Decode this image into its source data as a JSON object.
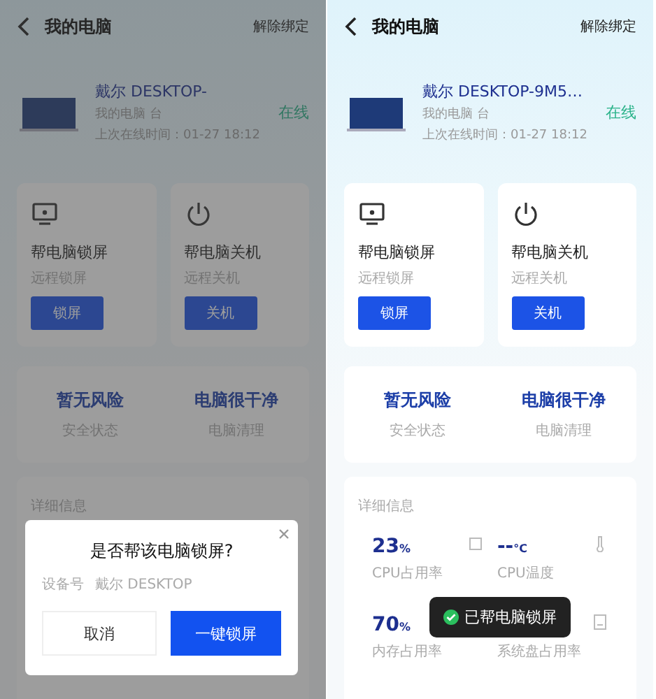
{
  "screens": [
    {
      "dimmed": true,
      "header": {
        "title": "我的电脑",
        "action": "解除绑定"
      },
      "device": {
        "name": "戴尔 DESKTOP-",
        "subtitle": "我的电脑 台",
        "last_online": "上次在线时间：01-27 18:12",
        "status": "在线"
      },
      "actions": [
        {
          "kind": "lock",
          "title": "帮电脑锁屏",
          "subtitle": "远程锁屏",
          "button": "锁屏"
        },
        {
          "kind": "power",
          "title": "帮电脑关机",
          "subtitle": "远程关机",
          "button": "关机"
        }
      ],
      "status": [
        {
          "value": "暂无风险",
          "label": "安全状态"
        },
        {
          "value": "电脑很干净",
          "label": "电脑清理"
        }
      ],
      "details": {
        "title": "详细信息"
      },
      "dialog": {
        "title": "是否帮该电脑锁屏?",
        "device_label": "设备号",
        "device_name": "戴尔 DESKTOP",
        "cancel": "取消",
        "confirm": "一键锁屏"
      }
    },
    {
      "dimmed": false,
      "header": {
        "title": "我的电脑",
        "action": "解除绑定"
      },
      "device": {
        "name": "戴尔 DESKTOP-9M5…",
        "subtitle": "我的电脑 台",
        "last_online": "上次在线时间：01-27 18:12",
        "status": "在线"
      },
      "actions": [
        {
          "kind": "lock",
          "title": "帮电脑锁屏",
          "subtitle": "远程锁屏",
          "button": "锁屏"
        },
        {
          "kind": "power",
          "title": "帮电脑关机",
          "subtitle": "远程关机",
          "button": "关机"
        }
      ],
      "status": [
        {
          "value": "暂无风险",
          "label": "安全状态"
        },
        {
          "value": "电脑很干净",
          "label": "电脑清理"
        }
      ],
      "details": {
        "title": "详细信息",
        "stats": [
          {
            "kind": "cpu",
            "value": "23",
            "unit": "%",
            "label": "CPU占用率"
          },
          {
            "kind": "temp",
            "value": "--",
            "unit": "°C",
            "label": "CPU温度"
          },
          {
            "kind": "memory",
            "value": "70",
            "unit": "%",
            "label": "内存占用率"
          },
          {
            "kind": "disk",
            "label": "系统盘占用率"
          }
        ]
      },
      "toast": {
        "text": "已帮电脑锁屏"
      }
    }
  ]
}
